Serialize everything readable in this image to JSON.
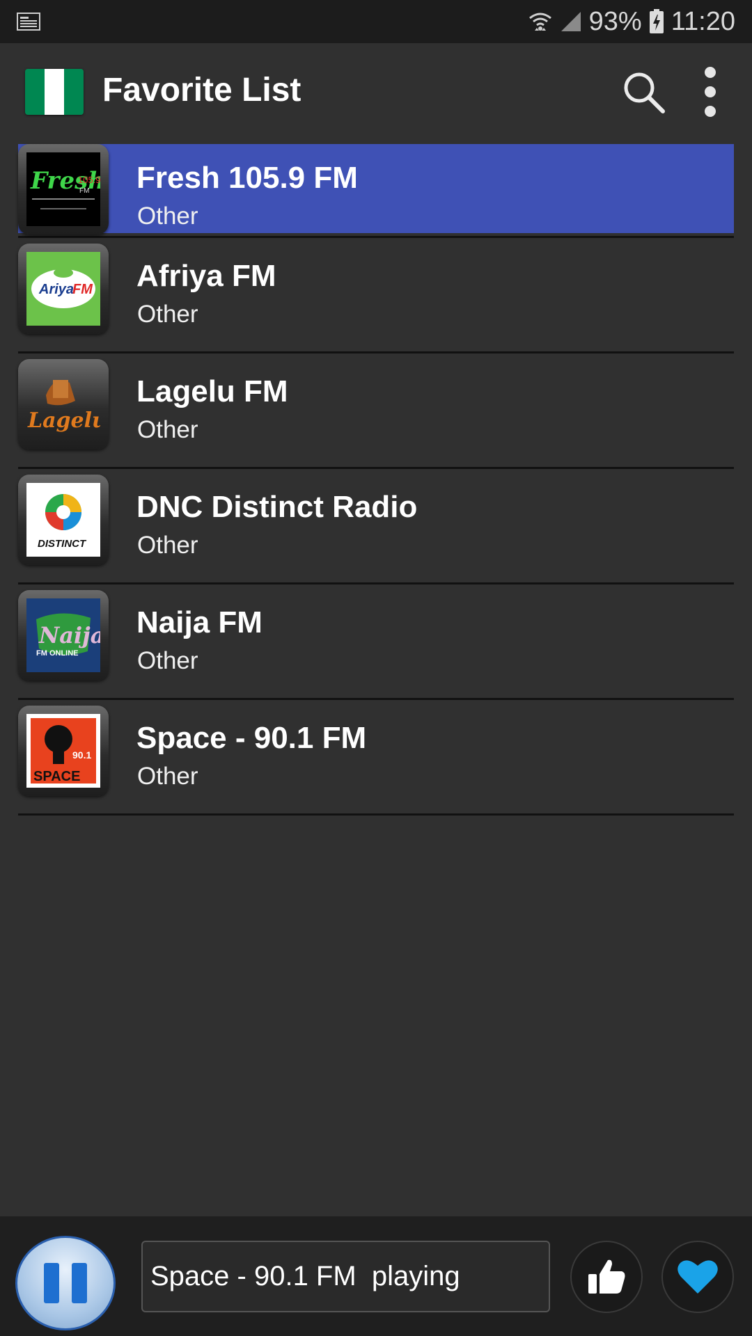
{
  "status_bar": {
    "battery": "93%",
    "time": "11:20",
    "icons": [
      "news-icon",
      "wifi-icon",
      "cellular-signal-icon",
      "battery-charging-icon"
    ]
  },
  "app_bar": {
    "title": "Favorite List",
    "flag_colors": [
      "#008751",
      "#ffffff",
      "#008751"
    ],
    "actions": [
      "search-icon",
      "more-vert-icon"
    ]
  },
  "stations": [
    {
      "name": "Fresh 105.9 FM",
      "genre": "Other",
      "selected": true,
      "logo": "fresh-fm-logo"
    },
    {
      "name": "Afriya FM",
      "genre": "Other",
      "selected": false,
      "logo": "afriya-fm-logo"
    },
    {
      "name": "Lagelu FM",
      "genre": "Other",
      "selected": false,
      "logo": "lagelu-fm-logo"
    },
    {
      "name": "DNC Distinct Radio",
      "genre": "Other",
      "selected": false,
      "logo": "distinct-radio-logo"
    },
    {
      "name": "Naija FM",
      "genre": "Other",
      "selected": false,
      "logo": "naija-fm-logo"
    },
    {
      "name": "Space - 90.1 FM",
      "genre": "Other",
      "selected": false,
      "logo": "space-fm-logo"
    }
  ],
  "player": {
    "now_playing": "Space - 90.1 FM  playing",
    "buttons": [
      "pause-icon",
      "thumbs-up-icon",
      "heart-icon"
    ],
    "accent": "#3f51b5",
    "heart_color": "#1aa3e8"
  }
}
